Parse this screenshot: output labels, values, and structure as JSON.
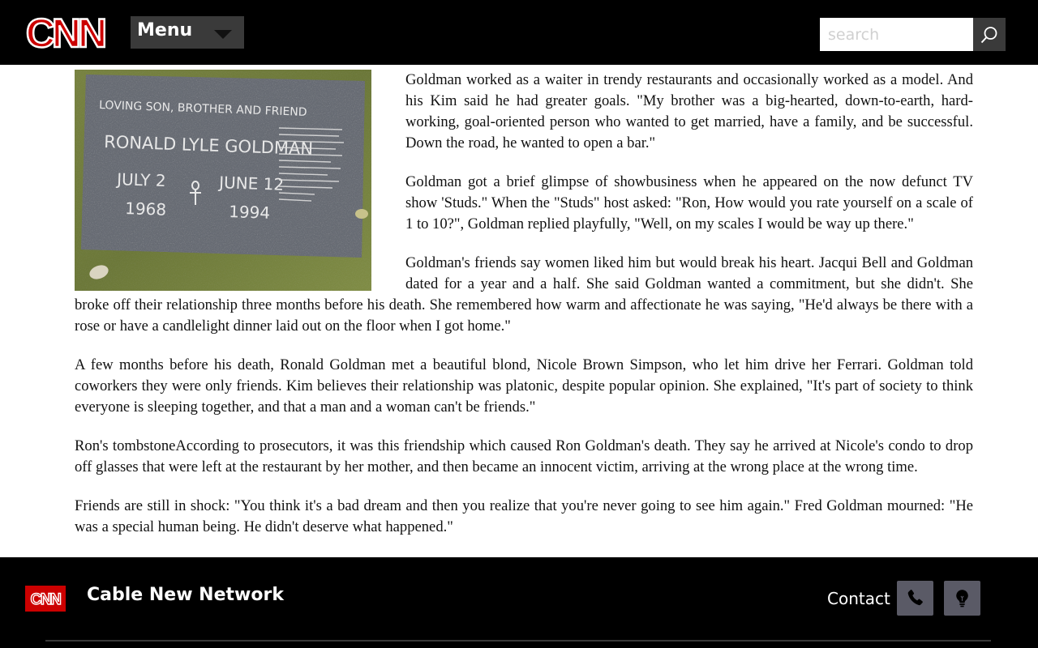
{
  "header": {
    "logo_text": "CNN",
    "menu_label": "Menu",
    "search_placeholder": "search",
    "search_icon": "search-icon",
    "menu_icon": "caret-down-icon"
  },
  "photo": {
    "epitaph": "LOVING SON, BROTHER AND FRIEND",
    "name": "RONALD LYLE GOLDMAN",
    "birth_month_day": "JULY 2",
    "birth_year": "1968",
    "death_month_day": "JUNE 12",
    "death_year": "1994"
  },
  "article": {
    "paragraphs": [
      "Goldman worked as a waiter in trendy restaurants and occasionally worked as a model. And his Kim said he had greater goals. \"My brother was a big-hearted, down-to-earth, hard-working, goal-oriented person who wanted to get married, have a family, and be successful. Down the road, he wanted to open a bar.\"",
      "Goldman got a brief glimpse of showbusiness when he appeared on the now defunct TV show 'Studs.\" When the \"Studs\" host asked: \"Ron, How would you rate yourself on a scale of 1 to 10?\", Goldman replied playfully, \"Well, on my scales I would be way up there.\"",
      "Goldman's friends say women liked him but would break his heart. Jacqui Bell and Goldman dated for a year and a half. She said Goldman wanted a commitment, but she didn't. She broke off their relationship three months before his death. She remembered how warm and affectionate he was saying, \"He'd always be there with a rose or have a candlelight dinner laid out on the floor when I got home.\"",
      "A few months before his death, Ronald Goldman met a beautiful blond, Nicole Brown Simpson, who let him drive her Ferrari. Goldman told coworkers they were only friends. Kim believes their relationship was platonic, despite popular opinion. She explained, \"It's part of society to think everyone is sleeping together, and that a man and a woman can't be friends.\"",
      "Ron's tombstoneAccording to prosecutors, it was this friendship which caused Ron Goldman's death. They say he arrived at Nicole's condo to drop off glasses that were left at the restaurant by her mother, and then became an innocent victim, arriving at the wrong place at the wrong time.",
      "Friends are still in shock: \"You think it's a bad dream and then you realize that you're never going to see him again.\" Fred Goldman mourned: \"He was a special human being. He didn't deserve what happened.\""
    ]
  },
  "footer": {
    "logo_text": "CNN",
    "title": "Cable New Network",
    "contact_label": "Contact",
    "phone_icon": "phone-icon",
    "lightbulb_icon": "lightbulb-icon"
  },
  "colors": {
    "brand_red": "#cc0000",
    "header_bg": "#000000",
    "button_bg": "#3a3a3a",
    "footer_icon_bg": "#5a5a66"
  }
}
